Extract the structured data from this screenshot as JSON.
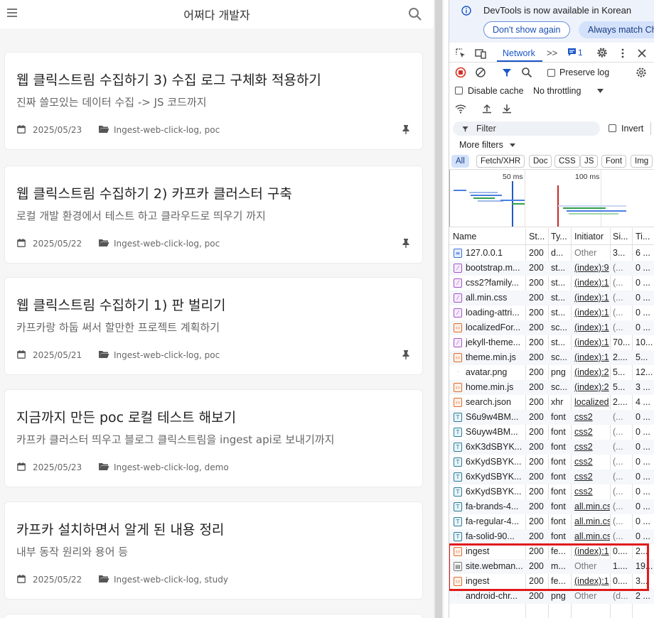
{
  "blog": {
    "site_title": "어쩌다 개발자",
    "posts": [
      {
        "title": "웹 클릭스트림 수집하기 3) 수집 로그 구체화 적용하기",
        "desc": "진짜 쓸모있는 데이터 수집 -> JS 코드까지",
        "date": "2025/05/23",
        "categories": "Ingest-web-click-log, poc",
        "pinned": true
      },
      {
        "title": "웹 클릭스트림 수집하기 2) 카프카 클러스터 구축",
        "desc": "로컬 개발 환경에서 테스트 하고 클라우드로 띄우기 까지",
        "date": "2025/05/22",
        "categories": "Ingest-web-click-log, poc",
        "pinned": true
      },
      {
        "title": "웹 클릭스트림 수집하기 1) 판 벌리기",
        "desc": "카프카랑 하둡 써서 할만한 프로젝트 계획하기",
        "date": "2025/05/21",
        "categories": "Ingest-web-click-log, poc",
        "pinned": true
      },
      {
        "title": "지금까지 만든 poc 로컬 테스트 해보기",
        "desc": "카프카 클러스터 띄우고 블로그 클릭스트림을 ingest api로 보내기까지",
        "date": "2025/05/23",
        "categories": "Ingest-web-click-log, demo",
        "pinned": false
      },
      {
        "title": "카프카 설치하면서 알게 된 내용 정리",
        "desc": "내부 동작 원리와 용어 등",
        "date": "2025/05/22",
        "categories": "Ingest-web-click-log, study",
        "pinned": false
      }
    ]
  },
  "devtools": {
    "notice_text": "DevTools is now available in Korean",
    "dont_show_label": "Don't show again",
    "always_match_label": "Always match Ch",
    "tab_network": "Network",
    "more_tabs": ">>",
    "issues_count": "1",
    "preserve_log": "Preserve log",
    "disable_cache": "Disable cache",
    "throttling": "No throttling",
    "filter_placeholder": "Filter",
    "invert": "Invert",
    "more_filters": "More filters",
    "type_chips": [
      "All",
      "Fetch/XHR",
      "Doc",
      "CSS",
      "JS",
      "Font",
      "Img"
    ],
    "timeline_labels": [
      "50 ms",
      "100 ms"
    ],
    "columns": [
      "Name",
      "St...",
      "Ty...",
      "Initiator",
      "Si...",
      "Ti..."
    ],
    "rows": [
      {
        "ft": "doc",
        "name": "127.0.0.1",
        "status": "200",
        "type": "d...",
        "initiator": "Other",
        "init_link": false,
        "size": "3...",
        "time": "6 ..."
      },
      {
        "ft": "css",
        "name": "bootstrap.m...",
        "status": "200",
        "type": "st...",
        "initiator": "(index):9",
        "init_link": true,
        "size": "(...",
        "time": "0 ..."
      },
      {
        "ft": "css",
        "name": "css2?family...",
        "status": "200",
        "type": "st...",
        "initiator": "(index):1",
        "init_link": true,
        "size": "(...",
        "time": "0 ..."
      },
      {
        "ft": "css",
        "name": "all.min.css",
        "status": "200",
        "type": "st...",
        "initiator": "(index):1",
        "init_link": true,
        "size": "(...",
        "time": "0 ..."
      },
      {
        "ft": "css",
        "name": "loading-attri...",
        "status": "200",
        "type": "st...",
        "initiator": "(index):1",
        "init_link": true,
        "size": "(...",
        "time": "0 ..."
      },
      {
        "ft": "js",
        "name": "localizedFor...",
        "status": "200",
        "type": "sc...",
        "initiator": "(index):1",
        "init_link": true,
        "size": "(...",
        "time": "0 ..."
      },
      {
        "ft": "css",
        "name": "jekyll-theme...",
        "status": "200",
        "type": "st...",
        "initiator": "(index):1",
        "init_link": true,
        "size": "70...",
        "time": "10..."
      },
      {
        "ft": "js",
        "name": "theme.min.js",
        "status": "200",
        "type": "sc...",
        "initiator": "(index):1",
        "init_link": true,
        "size": "2....",
        "time": "5..."
      },
      {
        "ft": "img",
        "name": "avatar.png",
        "status": "200",
        "type": "png",
        "initiator": "(index):2",
        "init_link": true,
        "size": "5...",
        "time": "12..."
      },
      {
        "ft": "js",
        "name": "home.min.js",
        "status": "200",
        "type": "sc...",
        "initiator": "(index):2",
        "init_link": true,
        "size": "5...",
        "time": "3 ..."
      },
      {
        "ft": "js",
        "name": "search.json",
        "status": "200",
        "type": "xhr",
        "initiator": "localized",
        "init_link": true,
        "size": "2....",
        "time": "4 ..."
      },
      {
        "ft": "font",
        "name": "S6u9w4BM...",
        "status": "200",
        "type": "font",
        "initiator": "css2",
        "init_link": true,
        "size": "(...",
        "time": "0 ..."
      },
      {
        "ft": "font",
        "name": "S6uyw4BM...",
        "status": "200",
        "type": "font",
        "initiator": "css2",
        "init_link": true,
        "size": "(...",
        "time": "0 ..."
      },
      {
        "ft": "font",
        "name": "6xK3dSBYK...",
        "status": "200",
        "type": "font",
        "initiator": "css2",
        "init_link": true,
        "size": "(...",
        "time": "0 ..."
      },
      {
        "ft": "font",
        "name": "6xKydSBYK...",
        "status": "200",
        "type": "font",
        "initiator": "css2",
        "init_link": true,
        "size": "(...",
        "time": "0 ..."
      },
      {
        "ft": "font",
        "name": "6xKydSBYK...",
        "status": "200",
        "type": "font",
        "initiator": "css2",
        "init_link": true,
        "size": "(...",
        "time": "0 ..."
      },
      {
        "ft": "font",
        "name": "6xKydSBYK...",
        "status": "200",
        "type": "font",
        "initiator": "css2",
        "init_link": true,
        "size": "(...",
        "time": "0 ..."
      },
      {
        "ft": "font",
        "name": "fa-brands-4...",
        "status": "200",
        "type": "font",
        "initiator": "all.min.cs",
        "init_link": true,
        "size": "(...",
        "time": "0 ..."
      },
      {
        "ft": "font",
        "name": "fa-regular-4...",
        "status": "200",
        "type": "font",
        "initiator": "all.min.cs",
        "init_link": true,
        "size": "(...",
        "time": "0 ..."
      },
      {
        "ft": "font",
        "name": "fa-solid-90...",
        "status": "200",
        "type": "font",
        "initiator": "all.min.cs",
        "init_link": true,
        "size": "(...",
        "time": "0 ..."
      },
      {
        "ft": "js",
        "name": "ingest",
        "status": "200",
        "type": "fe...",
        "initiator": "(index):1",
        "init_link": true,
        "size": "0....",
        "time": "2..."
      },
      {
        "ft": "manifest",
        "name": "site.webman...",
        "status": "200",
        "type": "m...",
        "initiator": "Other",
        "init_link": false,
        "size": "1....",
        "time": "19..."
      },
      {
        "ft": "js",
        "name": "ingest",
        "status": "200",
        "type": "fe...",
        "initiator": "(index):1",
        "init_link": true,
        "size": "0....",
        "time": "3..."
      },
      {
        "ft": "img",
        "name": "android-chr...",
        "status": "200",
        "type": "png",
        "initiator": "Other",
        "init_link": false,
        "size": "(d...",
        "time": "2 ..."
      }
    ],
    "colors": {
      "accent": "#1a56c8",
      "highlight": "#e11a1a"
    }
  }
}
